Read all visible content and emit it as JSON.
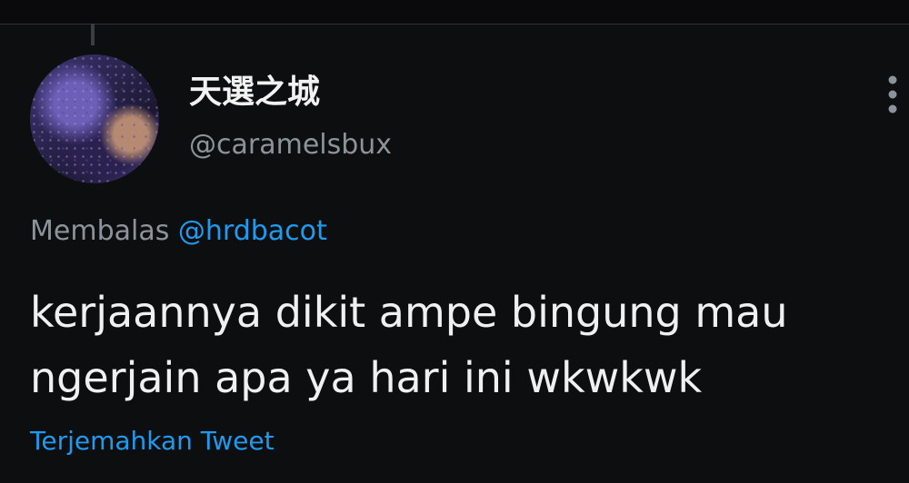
{
  "tweet": {
    "author": {
      "display_name": "天選之城",
      "handle": "@caramelsbux"
    },
    "reply": {
      "prefix": "Membalas",
      "mention": "@hrdbacot"
    },
    "text_lines": [
      "kerjaannya dikit ampe bingung mau",
      "ngerjain apa ya hari ini wkwkwk"
    ],
    "translate_label": "Terjemahkan Tweet",
    "icons": {
      "more": "more-vertical-icon"
    },
    "colors": {
      "background": "#0d0e10",
      "text_primary": "#e7e9ea",
      "text_secondary": "#8b949b",
      "link": "#1d9bf0"
    }
  }
}
